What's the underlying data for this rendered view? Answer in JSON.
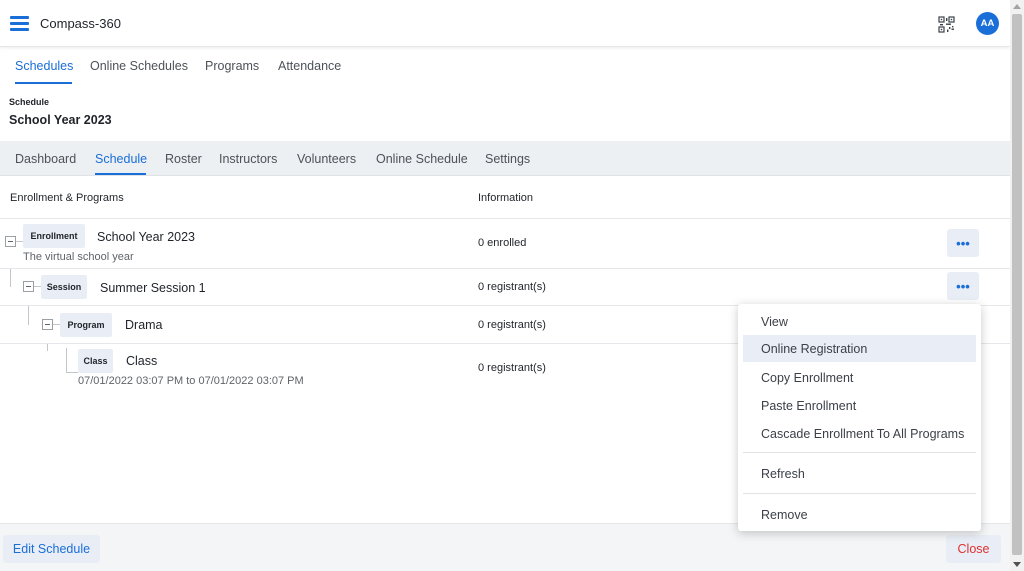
{
  "app": {
    "title": "Compass-360",
    "avatar_initials": "AA"
  },
  "main_tabs": [
    {
      "label": "Schedules",
      "active": true
    },
    {
      "label": "Online Schedules",
      "active": false
    },
    {
      "label": "Programs",
      "active": false
    },
    {
      "label": "Attendance",
      "active": false
    }
  ],
  "schedule": {
    "label": "Schedule",
    "name": "School Year 2023"
  },
  "sub_tabs": [
    {
      "label": "Dashboard",
      "active": false
    },
    {
      "label": "Schedule",
      "active": true
    },
    {
      "label": "Roster",
      "active": false
    },
    {
      "label": "Instructors",
      "active": false
    },
    {
      "label": "Volunteers",
      "active": false
    },
    {
      "label": "Online Schedule",
      "active": false
    },
    {
      "label": "Settings",
      "active": false
    }
  ],
  "table": {
    "headers": {
      "enrollment": "Enrollment & Programs",
      "information": "Information"
    },
    "rows": [
      {
        "type": "Enrollment",
        "name": "School Year 2023",
        "description": "The virtual school year",
        "info": "0 enrolled"
      },
      {
        "type": "Session",
        "name": "Summer Session 1",
        "description": "",
        "info": "0 registrant(s)"
      },
      {
        "type": "Program",
        "name": "Drama",
        "description": "",
        "info": "0 registrant(s)"
      },
      {
        "type": "Class",
        "name": "Class",
        "description": "07/01/2022 03:07 PM to 07/01/2022 03:07 PM",
        "info": "0 registrant(s)"
      }
    ],
    "more_label": "•••"
  },
  "context_menu": {
    "items": [
      {
        "label": "View"
      },
      {
        "label": "Online Registration",
        "hover": true
      },
      {
        "label": "Copy Enrollment"
      },
      {
        "label": "Paste Enrollment"
      },
      {
        "label": "Cascade Enrollment To All Programs"
      },
      {
        "label": "Refresh"
      },
      {
        "label": "Remove"
      }
    ]
  },
  "footer": {
    "edit_label": "Edit Schedule",
    "close_label": "Close"
  },
  "colors": {
    "accent": "#1a6ed8",
    "danger": "#e0312f",
    "badge_bg": "#e9eef6",
    "subtab_bg": "#edf0f3"
  },
  "icons": {
    "menu": "hamburger-icon",
    "scan": "qr-code-icon",
    "collapse": "minus-square-icon",
    "more": "more-horizontal-icon"
  }
}
